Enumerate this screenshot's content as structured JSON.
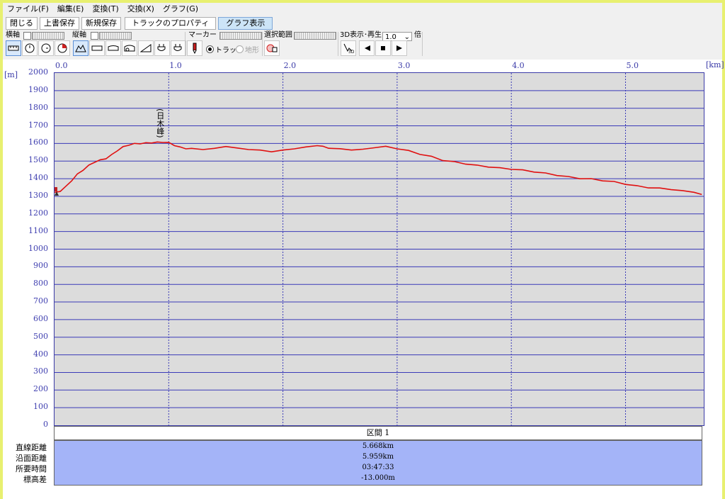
{
  "menu": [
    "ファイル(F)",
    "編集(E)",
    "変換(T)",
    "交換(X)",
    "グラフ(G)"
  ],
  "buttons": {
    "close": "閉じる",
    "overwrite": "上書保存",
    "save_new": "新規保存",
    "track_properties": "トラックのプロパティ",
    "graph_view": "グラフ表示"
  },
  "toolbar": {
    "x_axis_label": "横軸",
    "y_axis_label": "縦軸",
    "marker_label": "マーカー",
    "selection_label": "選択範囲",
    "playback_label": "3D表示･再生",
    "speed_value": "1.0",
    "speed_unit": "倍",
    "radio_track": "トラック",
    "radio_terrain": "地形",
    "btn_3d": "3D"
  },
  "chart_data": {
    "type": "line",
    "x_unit": "[km]",
    "y_unit": "[m]",
    "x_ticks": [
      "0.0",
      "1.0",
      "2.0",
      "3.0",
      "4.0",
      "5.0"
    ],
    "y_ticks": [
      "2000",
      "1900",
      "1800",
      "1700",
      "1600",
      "1500",
      "1400",
      "1300",
      "1200",
      "1100",
      "1000",
      "900",
      "800",
      "700",
      "600",
      "500",
      "400",
      "300",
      "200",
      "100",
      "0"
    ],
    "xlim": [
      0,
      5.668
    ],
    "ylim": [
      0,
      2000
    ],
    "grid": true,
    "annotation": {
      "text": "(日木峰)",
      "x": 0.95
    },
    "series": [
      {
        "color": "#e01010",
        "x": [
          0.0,
          0.05,
          0.1,
          0.15,
          0.2,
          0.25,
          0.3,
          0.35,
          0.4,
          0.45,
          0.5,
          0.55,
          0.6,
          0.65,
          0.7,
          0.75,
          0.8,
          0.85,
          0.9,
          0.95,
          1.0,
          1.05,
          1.1,
          1.15,
          1.2,
          1.3,
          1.4,
          1.5,
          1.6,
          1.7,
          1.8,
          1.9,
          2.0,
          2.1,
          2.2,
          2.3,
          2.35,
          2.4,
          2.5,
          2.6,
          2.7,
          2.8,
          2.9,
          3.0,
          3.1,
          3.2,
          3.3,
          3.4,
          3.5,
          3.6,
          3.7,
          3.8,
          3.9,
          4.0,
          4.1,
          4.2,
          4.3,
          4.4,
          4.5,
          4.6,
          4.7,
          4.8,
          4.9,
          5.0,
          5.1,
          5.2,
          5.3,
          5.4,
          5.5,
          5.6,
          5.668
        ],
        "y": [
          1320,
          1330,
          1355,
          1390,
          1425,
          1450,
          1475,
          1495,
          1505,
          1515,
          1535,
          1560,
          1580,
          1592,
          1598,
          1600,
          1602,
          1605,
          1606,
          1608,
          1604,
          1590,
          1578,
          1572,
          1570,
          1568,
          1570,
          1585,
          1572,
          1568,
          1560,
          1555,
          1560,
          1572,
          1578,
          1590,
          1582,
          1575,
          1568,
          1565,
          1565,
          1578,
          1582,
          1572,
          1558,
          1540,
          1525,
          1505,
          1495,
          1485,
          1475,
          1468,
          1460,
          1455,
          1448,
          1440,
          1430,
          1420,
          1410,
          1402,
          1398,
          1390,
          1382,
          1370,
          1358,
          1350,
          1345,
          1340,
          1330,
          1325,
          1308
        ]
      }
    ]
  },
  "summary": {
    "header": "区間 1",
    "rows": [
      {
        "label": "直線距離",
        "value": "5.668km"
      },
      {
        "label": "沿面距離",
        "value": "5.959km"
      },
      {
        "label": "所要時間",
        "value": "03:47:33"
      },
      {
        "label": "標高差",
        "value": "-13.000m"
      }
    ]
  }
}
